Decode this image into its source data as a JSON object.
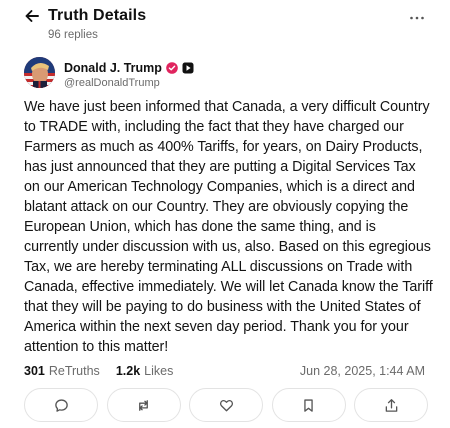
{
  "header": {
    "title": "Truth Details",
    "replies": "96 replies",
    "back_icon": "arrow-left-icon",
    "more_icon": "more-horizontal-icon"
  },
  "author": {
    "display_name": "Donald J. Trump",
    "handle": "@realDonaldTrump",
    "verified_icon": "verified-badge-icon",
    "verified_color": "#e0245e",
    "media_icon": "media-badge-icon"
  },
  "post": {
    "text": "We have just been informed that Canada, a very difficult Country to TRADE with, including the fact that they have charged our Farmers as much as 400% Tariffs, for years, on Dairy Products, has just announced that they are putting a Digital Services Tax on our American Technology Companies, which is a direct and blatant attack on our Country. They are obviously copying the European Union, which has done the same thing, and is currently under discussion with us, also. Based on this egregious Tax, we are hereby terminating ALL discussions on Trade with Canada, effective immediately. We will let Canada know the Tariff that they will be paying to do business with the United States of America within the next seven day period. Thank you for your attention to this matter!"
  },
  "stats": {
    "retruths_count": "301",
    "retruths_label": "ReTruths",
    "likes_count": "1.2k",
    "likes_label": "Likes",
    "timestamp": "Jun 28, 2025, 1:44 AM"
  },
  "actions": [
    {
      "name": "reply",
      "icon": "reply-bubble-icon"
    },
    {
      "name": "retruth",
      "icon": "retruth-arrows-icon"
    },
    {
      "name": "like",
      "icon": "heart-icon"
    },
    {
      "name": "bookmark",
      "icon": "bookmark-icon"
    },
    {
      "name": "share",
      "icon": "share-icon"
    }
  ],
  "colors": {
    "text": "#141414",
    "muted": "#6b6b6b",
    "border": "#e3e3e3"
  }
}
